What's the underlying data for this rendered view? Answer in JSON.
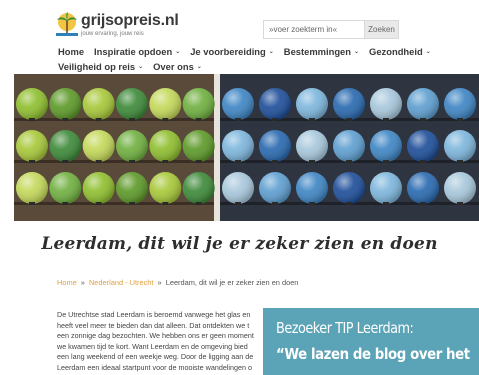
{
  "site": {
    "name": "grijsopreis.nl",
    "tagline": "jouw ervaring, jouw reis"
  },
  "search": {
    "placeholder": "»voer zoekterm in«",
    "button_label": "Zoeken"
  },
  "nav": {
    "row1": [
      {
        "label": "Home",
        "has_dropdown": false
      },
      {
        "label": "Inspiratie opdoen",
        "has_dropdown": true
      },
      {
        "label": "Je voorbereiding",
        "has_dropdown": true
      },
      {
        "label": "Bestemmingen",
        "has_dropdown": true
      },
      {
        "label": "Gezondheid",
        "has_dropdown": true
      }
    ],
    "row2": [
      {
        "label": "Veiligheid op reis",
        "has_dropdown": true
      },
      {
        "label": "Over ons",
        "has_dropdown": true
      }
    ]
  },
  "hero": {
    "alt": "",
    "left_palette": [
      "#8fbf2f",
      "#5e9a2a",
      "#a8c83a",
      "#3e8a3a",
      "#c4d85a",
      "#70b040"
    ],
    "right_palette": [
      "#3f86c4",
      "#1f4f9a",
      "#7eb6dc",
      "#2a6ab0",
      "#a8c8dc",
      "#5f9fd0"
    ]
  },
  "article": {
    "title": "Leerdam, dit wil je er zeker zien en doen",
    "breadcrumb": {
      "items": [
        "Home",
        "Nederland - Utrecht"
      ],
      "current": "Leerdam, dit wil je er zeker zien en doen",
      "separator": "»"
    },
    "body_lines": [
      "De Utrechtse stad Leerdam is beroemd vanwege het glas en",
      "heeft veel meer te bieden dan dat alleen. Dat ontdekten we t",
      "een zonnige dag bezochten. We hebben ons er geen moment",
      "we kwamen tijd te kort. Want Leerdam en de omgeving bied",
      "een lang weekend of een weekje weg. Door de ligging aan de",
      "Leerdam een ideaal startpunt voor de mooiste wandelingen o"
    ]
  },
  "popup": {
    "heading": "Bezoeker TIP Leerdam:",
    "quote": "“We lazen de blog over het"
  },
  "colors": {
    "accent_link": "#e0a040",
    "popup_bg": "#5ba3b6",
    "text_dark": "#3a3a3a"
  }
}
